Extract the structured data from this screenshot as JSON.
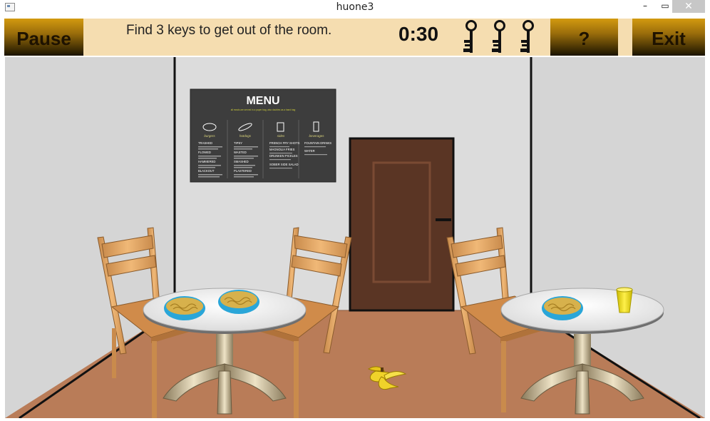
{
  "window": {
    "title": "huone3",
    "minimize_label": "–",
    "maximize_label": "▭",
    "close_label": "✕"
  },
  "hud": {
    "pause_label": "Pause",
    "instruction": "Find 3 keys to get out of the room.",
    "timer": "0:30",
    "keys_remaining": 3,
    "help_label": "?",
    "exit_label": "Exit"
  },
  "scene": {
    "menu_poster": {
      "title": "MENU",
      "subtitle": "all meals are served in a paper bag, also doubles as a hand bag",
      "columns": [
        {
          "heading": "burgers",
          "items": [
            "TRASHED",
            "FLOWED",
            "HAMMERED",
            "BLACKOUT"
          ]
        },
        {
          "heading": "hotdogs",
          "items": [
            "TIPSY",
            "WASTED",
            "SMASHED",
            "PLASTERED"
          ]
        },
        {
          "heading": "sides",
          "items": [
            "FRENCH FRY SHOTS",
            "MAGNOLIA FRIES",
            "DRUNKEN PICKLES",
            "SOBER SIDE SALAD"
          ]
        },
        {
          "heading": "beverages",
          "items": [
            "FOUNTAIN DRINKS",
            "WATER"
          ]
        }
      ]
    },
    "colors": {
      "hud_bar": "#f5ddb0",
      "button_top": "#d39a0f",
      "button_bottom": "#1a1300",
      "wall": "#d5d5d5",
      "floor": "#b97c58",
      "door": "#5a3524",
      "chair": "#e0a261",
      "table_top": "#f2f2f2",
      "table_base": "#d8c9a8",
      "banana": "#f0d22a",
      "cup": "#f2e21c"
    }
  }
}
